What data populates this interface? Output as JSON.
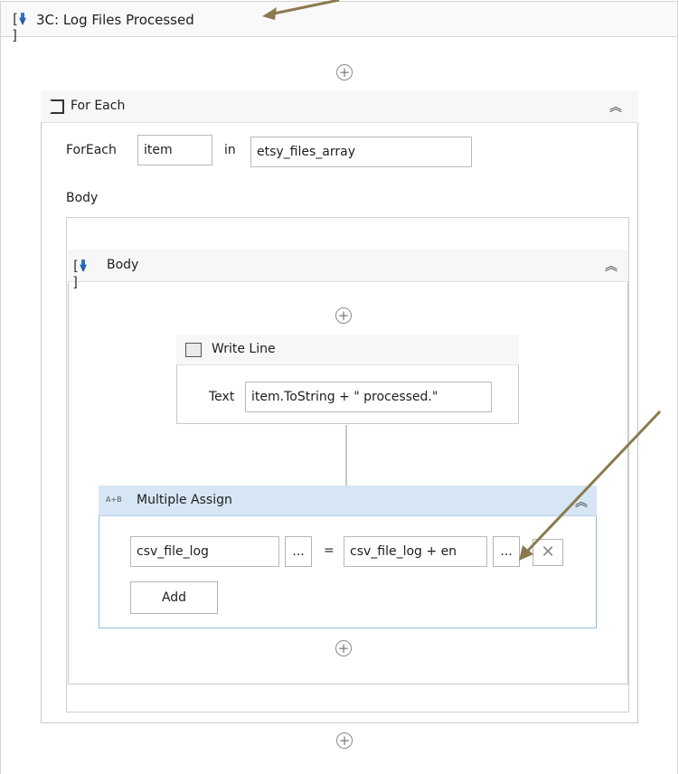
{
  "sequence": {
    "title": "3C: Log Files Processed"
  },
  "foreach": {
    "title": "For Each",
    "foreach_label": "ForEach",
    "item_value": "item",
    "in_label": "in",
    "collection_value": "etsy_files_array",
    "body_label": "Body"
  },
  "body_sequence": {
    "title": "Body"
  },
  "write_line": {
    "title": "Write Line",
    "text_label": "Text",
    "text_value": "item.ToString + \" processed.\""
  },
  "multiple_assign": {
    "title": "Multiple Assign",
    "icon_text": "A+B",
    "to_value": "csv_file_log",
    "equals": "=",
    "value_value": "csv_file_log + en",
    "ellipsis": "...",
    "add_label": "Add",
    "delete_symbol": "✕"
  },
  "ui": {
    "plus": "+",
    "collapse": "︽",
    "accent": "#8b7a4f",
    "header_bg": "#d6e6f4"
  }
}
